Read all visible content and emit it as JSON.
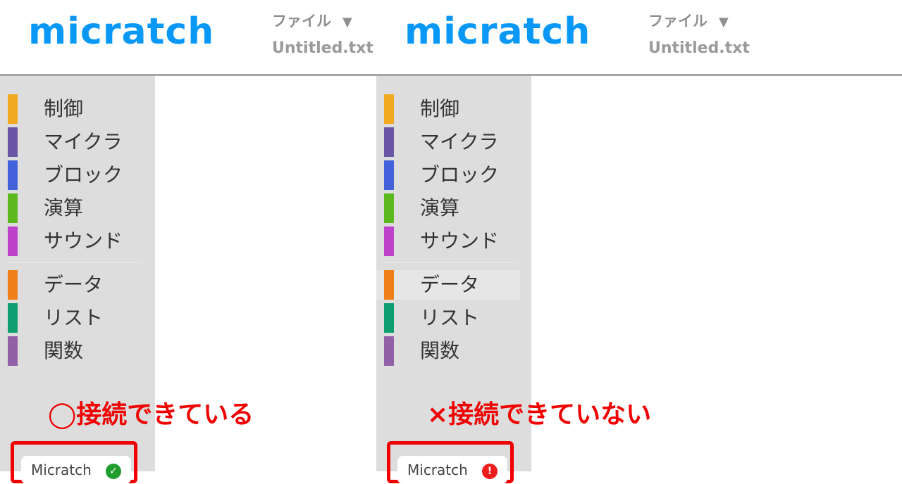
{
  "colors": {
    "logo": "#0a98f7",
    "annotation": "#f00000",
    "sidebar_bg": "#dddddd",
    "connected_icon": "#1f9d2f",
    "disconnected_icon": "#ee1c1c"
  },
  "panels": [
    {
      "logo": "micratch",
      "file_menu": {
        "label": "ファイル",
        "arrow": "▼"
      },
      "filename": "Untitled.txt",
      "categories": [
        {
          "label": "制御",
          "color": "#f2a922"
        },
        {
          "label": "マイクラ",
          "color": "#6b55a7"
        },
        {
          "label": "ブロック",
          "color": "#4461dc"
        },
        {
          "label": "演算",
          "color": "#5cb81d"
        },
        {
          "label": "サウンド",
          "color": "#bd42cc"
        },
        {
          "label": "データ",
          "color": "#f07f1a"
        },
        {
          "label": "リスト",
          "color": "#0f9e6f"
        },
        {
          "label": "関数",
          "color": "#9260a7"
        }
      ],
      "annotation": "◯接続できている",
      "status": {
        "label": "Micratch",
        "icon": "check-icon",
        "glyph": "✓"
      }
    },
    {
      "logo": "micratch",
      "file_menu": {
        "label": "ファイル",
        "arrow": "▼"
      },
      "filename": "Untitled.txt",
      "categories": [
        {
          "label": "制御",
          "color": "#f2a922"
        },
        {
          "label": "マイクラ",
          "color": "#6b55a7"
        },
        {
          "label": "ブロック",
          "color": "#4461dc"
        },
        {
          "label": "演算",
          "color": "#5cb81d"
        },
        {
          "label": "サウンド",
          "color": "#bd42cc"
        },
        {
          "label": "データ",
          "color": "#f07f1a",
          "selected": true
        },
        {
          "label": "リスト",
          "color": "#0f9e6f"
        },
        {
          "label": "関数",
          "color": "#9260a7"
        }
      ],
      "annotation": "×接続できていない",
      "status": {
        "label": "Micratch",
        "icon": "error-icon",
        "glyph": "!"
      }
    }
  ]
}
